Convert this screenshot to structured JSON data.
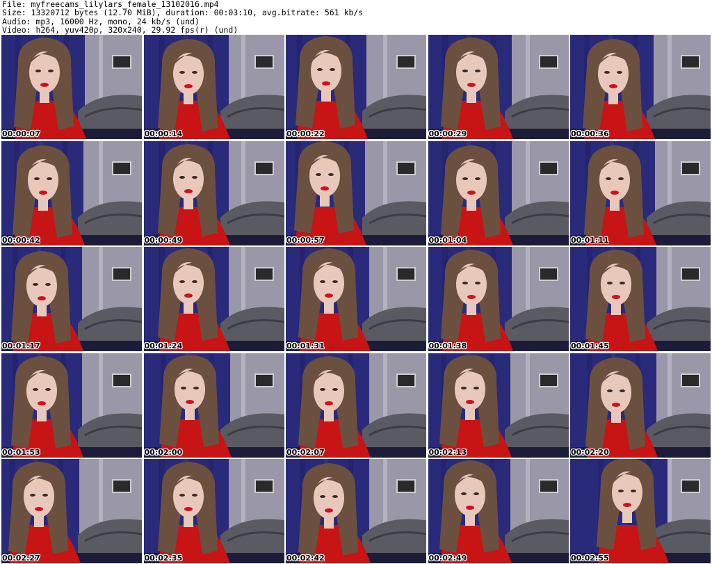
{
  "header": {
    "file": "File: myfreecams_lilylars_female_13102016.mp4",
    "size": "Size: 13320712 bytes (12.70 MiB), duration: 00:03:10, avg.bitrate: 561 kb/s",
    "audio": "Audio: mp3, 16000 Hz, mono, 24 kb/s (und)",
    "video": "Video: h264, yuv420p, 320x240, 29.92 fps(r) (und)"
  },
  "thumbnails": [
    {
      "time": "00:00:07"
    },
    {
      "time": "00:00:14"
    },
    {
      "time": "00:00:22"
    },
    {
      "time": "00:00:29"
    },
    {
      "time": "00:00:36"
    },
    {
      "time": "00:00:42"
    },
    {
      "time": "00:00:49"
    },
    {
      "time": "00:00:57"
    },
    {
      "time": "00:01:04"
    },
    {
      "time": "00:01:11"
    },
    {
      "time": "00:01:17"
    },
    {
      "time": "00:01:24"
    },
    {
      "time": "00:01:31"
    },
    {
      "time": "00:01:38"
    },
    {
      "time": "00:01:45"
    },
    {
      "time": "00:01:53"
    },
    {
      "time": "00:02:00"
    },
    {
      "time": "00:02:07"
    },
    {
      "time": "00:02:13"
    },
    {
      "time": "00:02:20"
    },
    {
      "time": "00:02:27"
    },
    {
      "time": "00:02:35"
    },
    {
      "time": "00:02:42"
    },
    {
      "time": "00:02:49"
    },
    {
      "time": "00:02:55"
    }
  ],
  "colors": {
    "curtain": "#2a2a7a",
    "wall": "#9a98a8",
    "sofa": "#5a5a62",
    "hair": "#6b5040",
    "skin": "#e9c8bc",
    "top": "#c81414",
    "lips": "#d01020"
  }
}
